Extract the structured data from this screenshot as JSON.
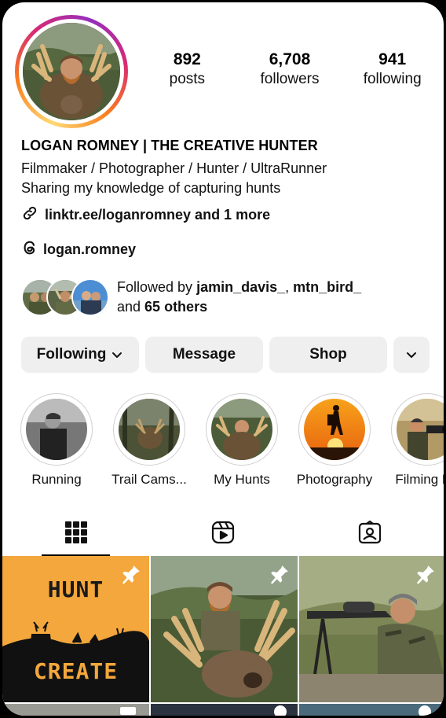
{
  "profile": {
    "stats": [
      {
        "value": "892",
        "label": "posts"
      },
      {
        "value": "6,708",
        "label": "followers"
      },
      {
        "value": "941",
        "label": "following"
      }
    ],
    "display_name": "LOGAN ROMNEY | THE CREATIVE HUNTER",
    "bio_lines": [
      "Filmmaker / Photographer / Hunter / UltraRunner",
      "Sharing my knowledge of capturing hunts"
    ],
    "link_text": "linktr.ee/loganromney and 1 more",
    "threads_handle": "logan.romney",
    "followed_by": {
      "prefix": "Followed by ",
      "user1": "jamin_davis_",
      "sep": ", ",
      "user2": "mtn_bird_",
      "and": "and ",
      "others": "65 others"
    }
  },
  "actions": {
    "following_label": "Following",
    "message_label": "Message",
    "shop_label": "Shop"
  },
  "highlights": [
    {
      "label": "Running"
    },
    {
      "label": "Trail Cams..."
    },
    {
      "label": "My Hunts"
    },
    {
      "label": "Photography"
    },
    {
      "label": "Filming Hu"
    }
  ],
  "tabs": [
    "grid-icon",
    "reels-icon",
    "tagged-icon"
  ],
  "posts": [
    {
      "line1": "HUNT",
      "line2": "CREATE",
      "pinned": true
    },
    {
      "pinned": true
    },
    {
      "pinned": true
    }
  ],
  "colors": {
    "poster_orange": "#f3a73c",
    "accent": "#0095f6"
  }
}
